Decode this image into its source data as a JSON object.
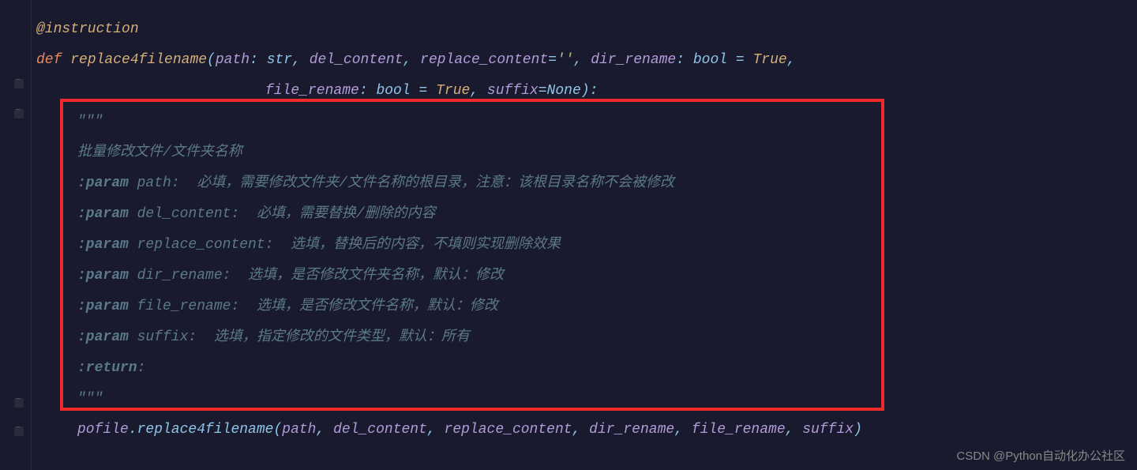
{
  "code": {
    "decorator": "@instruction",
    "def_kw": "def",
    "func_name": "replace4filename",
    "sig_line1": {
      "p1_name": "path",
      "p1_type": "str",
      "p2_name": "del_content",
      "p3_name": "replace_content",
      "p3_default": "''",
      "p4_name": "dir_rename",
      "p4_type": "bool",
      "p4_default": "True"
    },
    "sig_line2": {
      "p5_name": "file_rename",
      "p5_type": "bool",
      "p5_default": "True",
      "p6_name": "suffix",
      "p6_default": "None"
    },
    "docstring": {
      "triple_open": "\"\"\"",
      "title": "批量修改文件/文件夹名称",
      "params": [
        {
          "tag": ":param",
          "name": "path:",
          "desc": "  必填，需要修改文件夹/文件名称的根目录，注意：该根目录名称不会被修改"
        },
        {
          "tag": ":param",
          "name": "del_content:",
          "desc": "  必填，需要替换/删除的内容"
        },
        {
          "tag": ":param",
          "name": "replace_content:",
          "desc": "  选填，替换后的内容，不填则实现删除效果"
        },
        {
          "tag": ":param",
          "name": "dir_rename:",
          "desc": "  选填，是否修改文件夹名称，默认：修改"
        },
        {
          "tag": ":param",
          "name": "file_rename:",
          "desc": "  选填，是否修改文件名称，默认：修改"
        },
        {
          "tag": ":param",
          "name": "suffix:",
          "desc": "  选填，指定修改的文件类型，默认：所有"
        }
      ],
      "return_tag": ":return",
      "return_colon": ":",
      "triple_close": "\"\"\""
    },
    "call": {
      "obj": "pofile",
      "method": "replace4filename",
      "args": [
        "path",
        "del_content",
        "replace_content",
        "dir_rename",
        "file_rename",
        "suffix"
      ]
    }
  },
  "watermark": "CSDN @Python自动化办公社区"
}
